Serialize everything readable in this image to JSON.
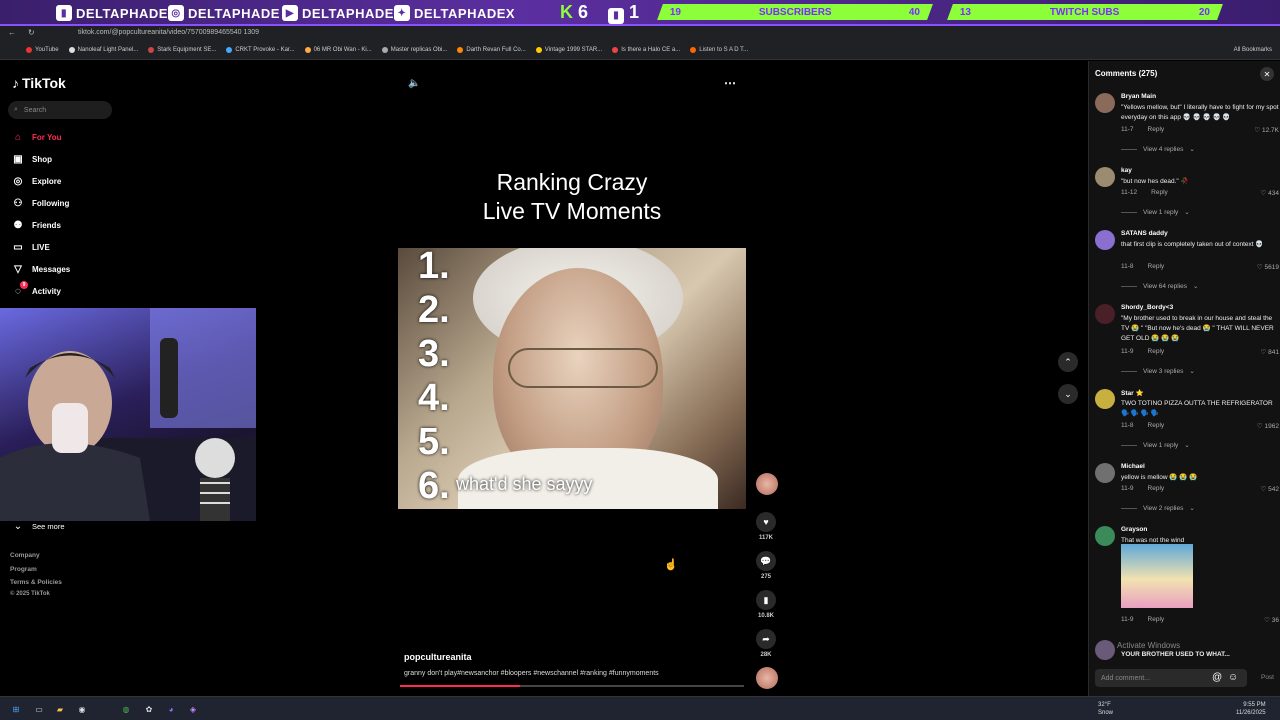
{
  "overlay": {
    "handles": [
      "DELTAPHADE",
      "DELTAPHADE",
      "DELTAPHADE",
      "DELTAPHADEX"
    ],
    "k_label": "K",
    "k_count": "6",
    "p_count": "1",
    "subs_left": "19",
    "subs_label": "SUBSCRIBERS",
    "subs_right": "40",
    "twitch_left": "13",
    "twitch_label": "TWITCH SUBS",
    "twitch_right": "20"
  },
  "browser": {
    "url": "tiktok.com/@popcultureanita/video/75700989465540 1309",
    "bookmarks": [
      "YouTube",
      "Nanoleaf Light Panel...",
      "Stark Equipment SE...",
      "CRKT Provoke - Kar...",
      "06 MR Obi Wan - Ki...",
      "Master replicas Obi...",
      "Darth Revan Full Co...",
      "Vintage 1999 STAR...",
      "Is there a Halo CE a...",
      "Listen to S A D T..."
    ],
    "all_bookmarks": "All Bookmarks"
  },
  "sidebar": {
    "logo": "TikTok",
    "search_placeholder": "Search",
    "items": [
      {
        "label": "For You",
        "icon": "home-icon"
      },
      {
        "label": "Shop",
        "icon": "shop-icon"
      },
      {
        "label": "Explore",
        "icon": "compass-icon"
      },
      {
        "label": "Following",
        "icon": "user-follow-icon"
      },
      {
        "label": "Friends",
        "icon": "friends-icon"
      },
      {
        "label": "LIVE",
        "icon": "live-icon"
      },
      {
        "label": "Messages",
        "icon": "messages-icon"
      },
      {
        "label": "Activity",
        "icon": "activity-icon"
      }
    ],
    "activity_badge": "9",
    "see_more": "See more",
    "footer": [
      "Company",
      "Program",
      "Terms & Policies",
      "© 2025 TikTok"
    ]
  },
  "video": {
    "title_line1": "Ranking Crazy",
    "title_line2": "Live TV Moments",
    "ranks": [
      "1.",
      "2.",
      "3.",
      "4.",
      "5.",
      "6."
    ],
    "caption": "what'd she sayyy",
    "author": "popcultureanita",
    "description": "granny don't play#newsanchor #bloopers #newschannel #ranking #funnymoments",
    "progress": 0.35,
    "likes": "117K",
    "comments_count": "275",
    "saves": "10.8K",
    "shares": "28K"
  },
  "comments": {
    "header": "Comments (275)",
    "reply_label": "Reply",
    "items": [
      {
        "user": "Bryan Main",
        "text": "\"Yellows mellow, but\" I literally have to fight for my spot everyday on this app 💀 💀 💀 💀 💀",
        "date": "11-7",
        "likes": "12.7K",
        "replies": "View 4 replies"
      },
      {
        "user": "kay",
        "text": "\"but now hes dead.\" 🥀",
        "date": "11-12",
        "likes": "434",
        "replies": "View 1 reply"
      },
      {
        "user": "SATANS daddy",
        "text": "that first clip is completely taken out of context 💀",
        "date": "11-8",
        "likes": "5619",
        "replies": "View 64 replies"
      },
      {
        "user": "Shordy_Bordy<3",
        "text": "\"My brother used to break in our house and steal the TV 😭 \" \"But now he's dead 😭 \" THAT WILL NEVER GET OLD 😭 😭 😭",
        "date": "11-9",
        "likes": "841",
        "replies": "View 3 replies"
      },
      {
        "user": "Star ⭐",
        "text": "TWO TOTINO PIZZA OUTTA THE REFRIGERATOR 🗣️ 🗣️ 🗣️ 🗣️",
        "date": "11-8",
        "likes": "1962",
        "replies": "View 1 reply"
      },
      {
        "user": "Michael",
        "text": "yellow is mellow 😭 😭 😭",
        "date": "11-9",
        "likes": "542",
        "replies": "View 2 replies"
      },
      {
        "user": "Grayson",
        "text": "That was not the wind",
        "date": "11-9",
        "likes": "36",
        "replies": ""
      },
      {
        "user": "",
        "text": "YOUR BROTHER USED TO WHAT...",
        "date": "",
        "likes": "",
        "replies": ""
      }
    ],
    "watermark": "Activate Windows",
    "add_placeholder": "Add comment...",
    "post": "Post"
  },
  "taskbar": {
    "weather_temp": "32°F",
    "weather_desc": "Snow",
    "time": "9:55 PM",
    "date": "11/26/2025"
  }
}
